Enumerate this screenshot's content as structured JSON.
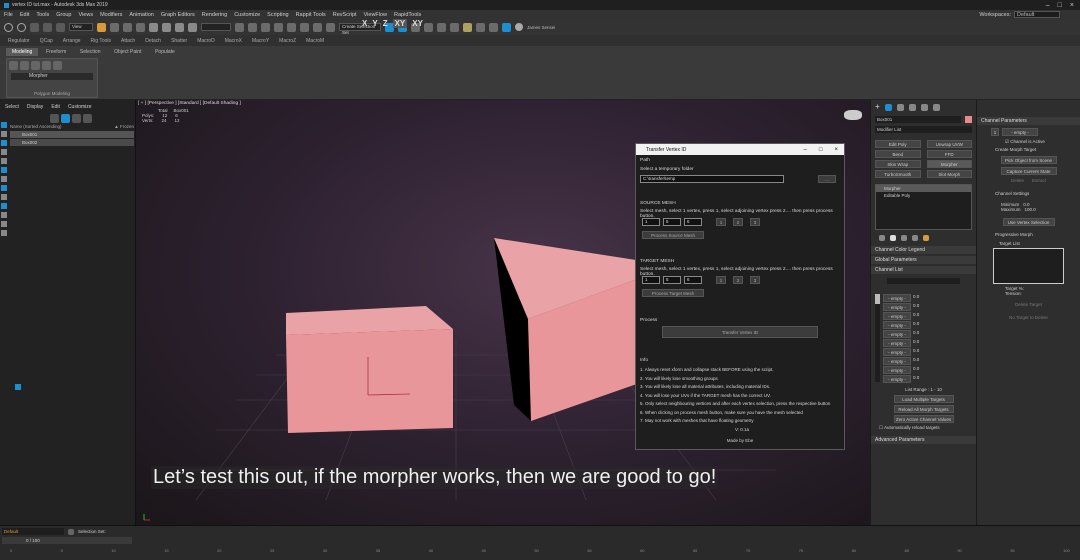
{
  "window": {
    "title": "vertex ID tut.max - Autodesk 3ds Max 2019"
  },
  "menu": [
    "File",
    "Edit",
    "Tools",
    "Group",
    "Views",
    "Modifiers",
    "Animation",
    "Graph Editors",
    "Rendering",
    "Customize",
    "Scripting",
    "Rappit Tools",
    "RevScript",
    "ViewFlow",
    "RapidTools"
  ],
  "workspace": {
    "label": "Workspaces:",
    "value": "Default"
  },
  "toolbar": {
    "view_select": "View",
    "selection_set": "Create Selection Set",
    "xyz": [
      "X",
      "Y",
      "Z",
      "XY",
      "XY"
    ],
    "user": "James Sensei"
  },
  "tb2_items": [
    "Regulator",
    "QCap",
    "Arrange",
    "Rig Tools",
    "Attach",
    "Detach",
    "Shatter",
    "MacroD",
    "MacroX",
    "MacroY",
    "MacroZ",
    "MacroM"
  ],
  "ribbon": {
    "tabs": [
      "Modeling",
      "Freeform",
      "Selection",
      "Object Paint",
      "Populate"
    ],
    "modifier_label": "Morpher",
    "panel_label": "Polygon Modeling"
  },
  "scene_explorer": {
    "menu": [
      "Select",
      "Display",
      "Edit",
      "Customize"
    ],
    "header": "Name (Sorted Ascending)",
    "frozen_header": "▲ Frozen",
    "items": [
      "Box001",
      "Box002"
    ]
  },
  "viewport": {
    "label": "[ + ] [Perspective ] [Standard ] [Default Shading ]",
    "stats_header": [
      "Total",
      "Box001"
    ],
    "stats": [
      {
        "name": "Polys:",
        "total": "12",
        "sel": "6"
      },
      {
        "name": "Verts:",
        "total": "24",
        "sel": "12"
      }
    ]
  },
  "subtitle": "Let’s test this out, if the morpher works, then we are good to go!",
  "dialog": {
    "title": "Transfer Vertex ID",
    "path_label": "Path",
    "temp_folder_label": "Select a temporary folder",
    "path_value": "C:\\transfer\\temp",
    "browse": "...",
    "source_header": "SOURCE MESH",
    "source_instr": "Select mesh, select 1 vertex, press 1, select adjoining vertex press 2.... then press process button.",
    "source_values": [
      "1",
      "5",
      "6"
    ],
    "num_buttons": [
      "1",
      "2",
      "3"
    ],
    "process_source": "Process Source Mesh",
    "target_header": "TARGET MESH",
    "target_instr": "Select mesh, select 1 vertex, press 1, select adjoining vertex press 2.... then press process button.",
    "target_values": [
      "1",
      "5",
      "6"
    ],
    "process_target": "Process Target Mesh",
    "process_label": "Process",
    "transfer_button": "Transfer Vertex ID",
    "info_label": "Info",
    "info_lines": [
      "1. Always reset xform and collapse stack BEFORE using the script.",
      "2. You will likely lose smoothing groups",
      "3. You will likely lose all material attributes, including material IDs.",
      "4. You will lose your UVs if the TARGET mesh has the correct UV.",
      "5. Only select neighbouring vertices and after each vertex selection, press the respective button",
      "6. When clicking on process mesh button, make sure you have the mesh selected",
      "7. May not work with meshes that have floating geometry"
    ],
    "version": "V: 0.1a",
    "credit": "Made by Ebe"
  },
  "command_panel": {
    "object_name": "Box001",
    "swatch_color": "#e88a8a",
    "modifier_list": "Modifier List",
    "buttons": [
      "Edit Poly",
      "Unwrap UVW",
      "Bend",
      "FFD",
      "Skin Wrap",
      "Morpher",
      "TurboSmooth",
      "Slot Morph"
    ],
    "stack": [
      "Morpher",
      "Editable Poly"
    ],
    "rollouts": [
      "Channel Color Legend",
      "Global Parameters",
      "Channel List"
    ],
    "load_target": "Load Multiple Targets",
    "reload_all": "Reload All Morph Targets",
    "zero_active": "Zero Active Channel Values",
    "auto_reload": "Automatically reload targets",
    "advanced": "Advanced Parameters",
    "channel_slots": [
      "- empty -",
      "- empty -",
      "- empty -",
      "- empty -",
      "- empty -",
      "- empty -",
      "- empty -",
      "- empty -",
      "- empty -",
      "- empty -"
    ],
    "channel_value": "0.0",
    "list_range": "List Range :  1 - 10"
  },
  "channel_params": {
    "header": "Channel Parameters",
    "slot": "1",
    "slot_label": "- empty -",
    "channel_active": "Channel is Active",
    "create_target": "Create Morph Target",
    "pick_object": "Pick Object from Scene",
    "capture_state": "Capture Current State",
    "delete": "Delete",
    "extract": "Extract",
    "channel_settings": "Channel Settings",
    "minimum_label": "Minimum",
    "minimum_value": "0.0",
    "maximum_label": "Maximum",
    "maximum_value": "100.0",
    "use_vertex_selection": "Use Vertex Selection",
    "progressive": "Progressive Morph",
    "target_list": "Target List",
    "target_pct": "Target %:",
    "tension": "Tension:",
    "delete_target": "Delete Target",
    "no_target": "No Target to Delete"
  },
  "status": {
    "default_field": "Default",
    "selection_set": "Selection Set:",
    "frame": "0 / 100"
  },
  "timeline_ticks": [
    "0",
    "5",
    "10",
    "15",
    "20",
    "25",
    "30",
    "35",
    "40",
    "45",
    "50",
    "55",
    "60",
    "65",
    "70",
    "75",
    "80",
    "85",
    "90",
    "95",
    "100"
  ],
  "colors": {
    "mesh": "#e9969a",
    "mesh_dark": "#c9767a",
    "accent": "#1d8fd0"
  }
}
